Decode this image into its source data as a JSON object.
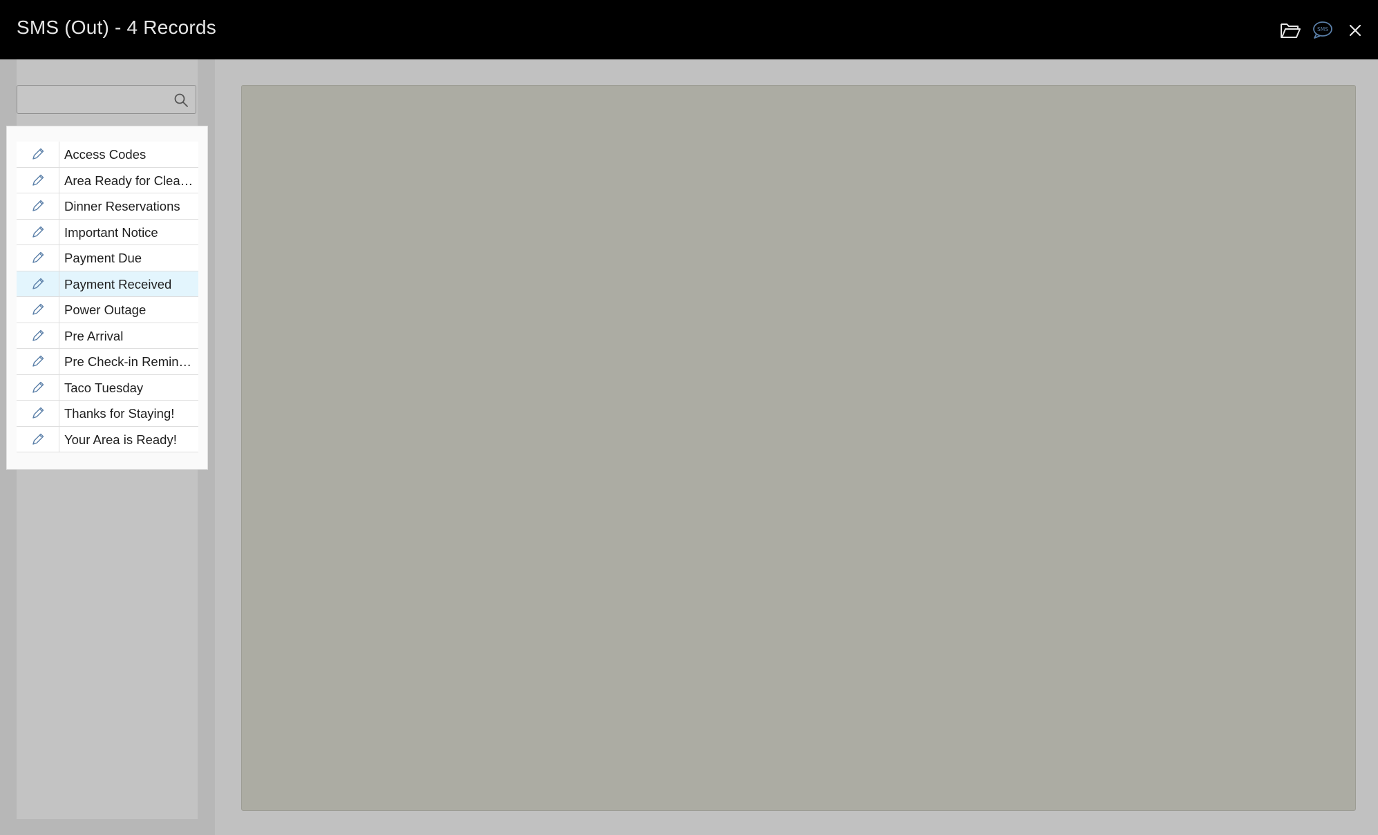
{
  "window": {
    "title": "SMS (Out) - 4 Records"
  },
  "toolbar": {
    "icons": [
      "folder-open-icon",
      "sms-icon",
      "close-icon"
    ],
    "sms_icon_text": "SMS"
  },
  "search": {
    "value": "",
    "placeholder": ""
  },
  "templates": {
    "items": [
      {
        "label": "Access Codes"
      },
      {
        "label": "Area Ready for Cleaning"
      },
      {
        "label": "Dinner Reservations"
      },
      {
        "label": "Important Notice"
      },
      {
        "label": "Payment Due"
      },
      {
        "label": "Payment Received"
      },
      {
        "label": "Power Outage"
      },
      {
        "label": "Pre Arrival"
      },
      {
        "label": "Pre Check-in Reminder"
      },
      {
        "label": "Taco Tuesday"
      },
      {
        "label": "Thanks for Staying!"
      },
      {
        "label": "Your Area is Ready!"
      }
    ],
    "selected": "Payment Received"
  },
  "colors": {
    "titlebar": "#000000",
    "selected_row": "#e3f5fd",
    "detail_panel": "#acaca3",
    "icon_blue": "#5a7fa8"
  }
}
